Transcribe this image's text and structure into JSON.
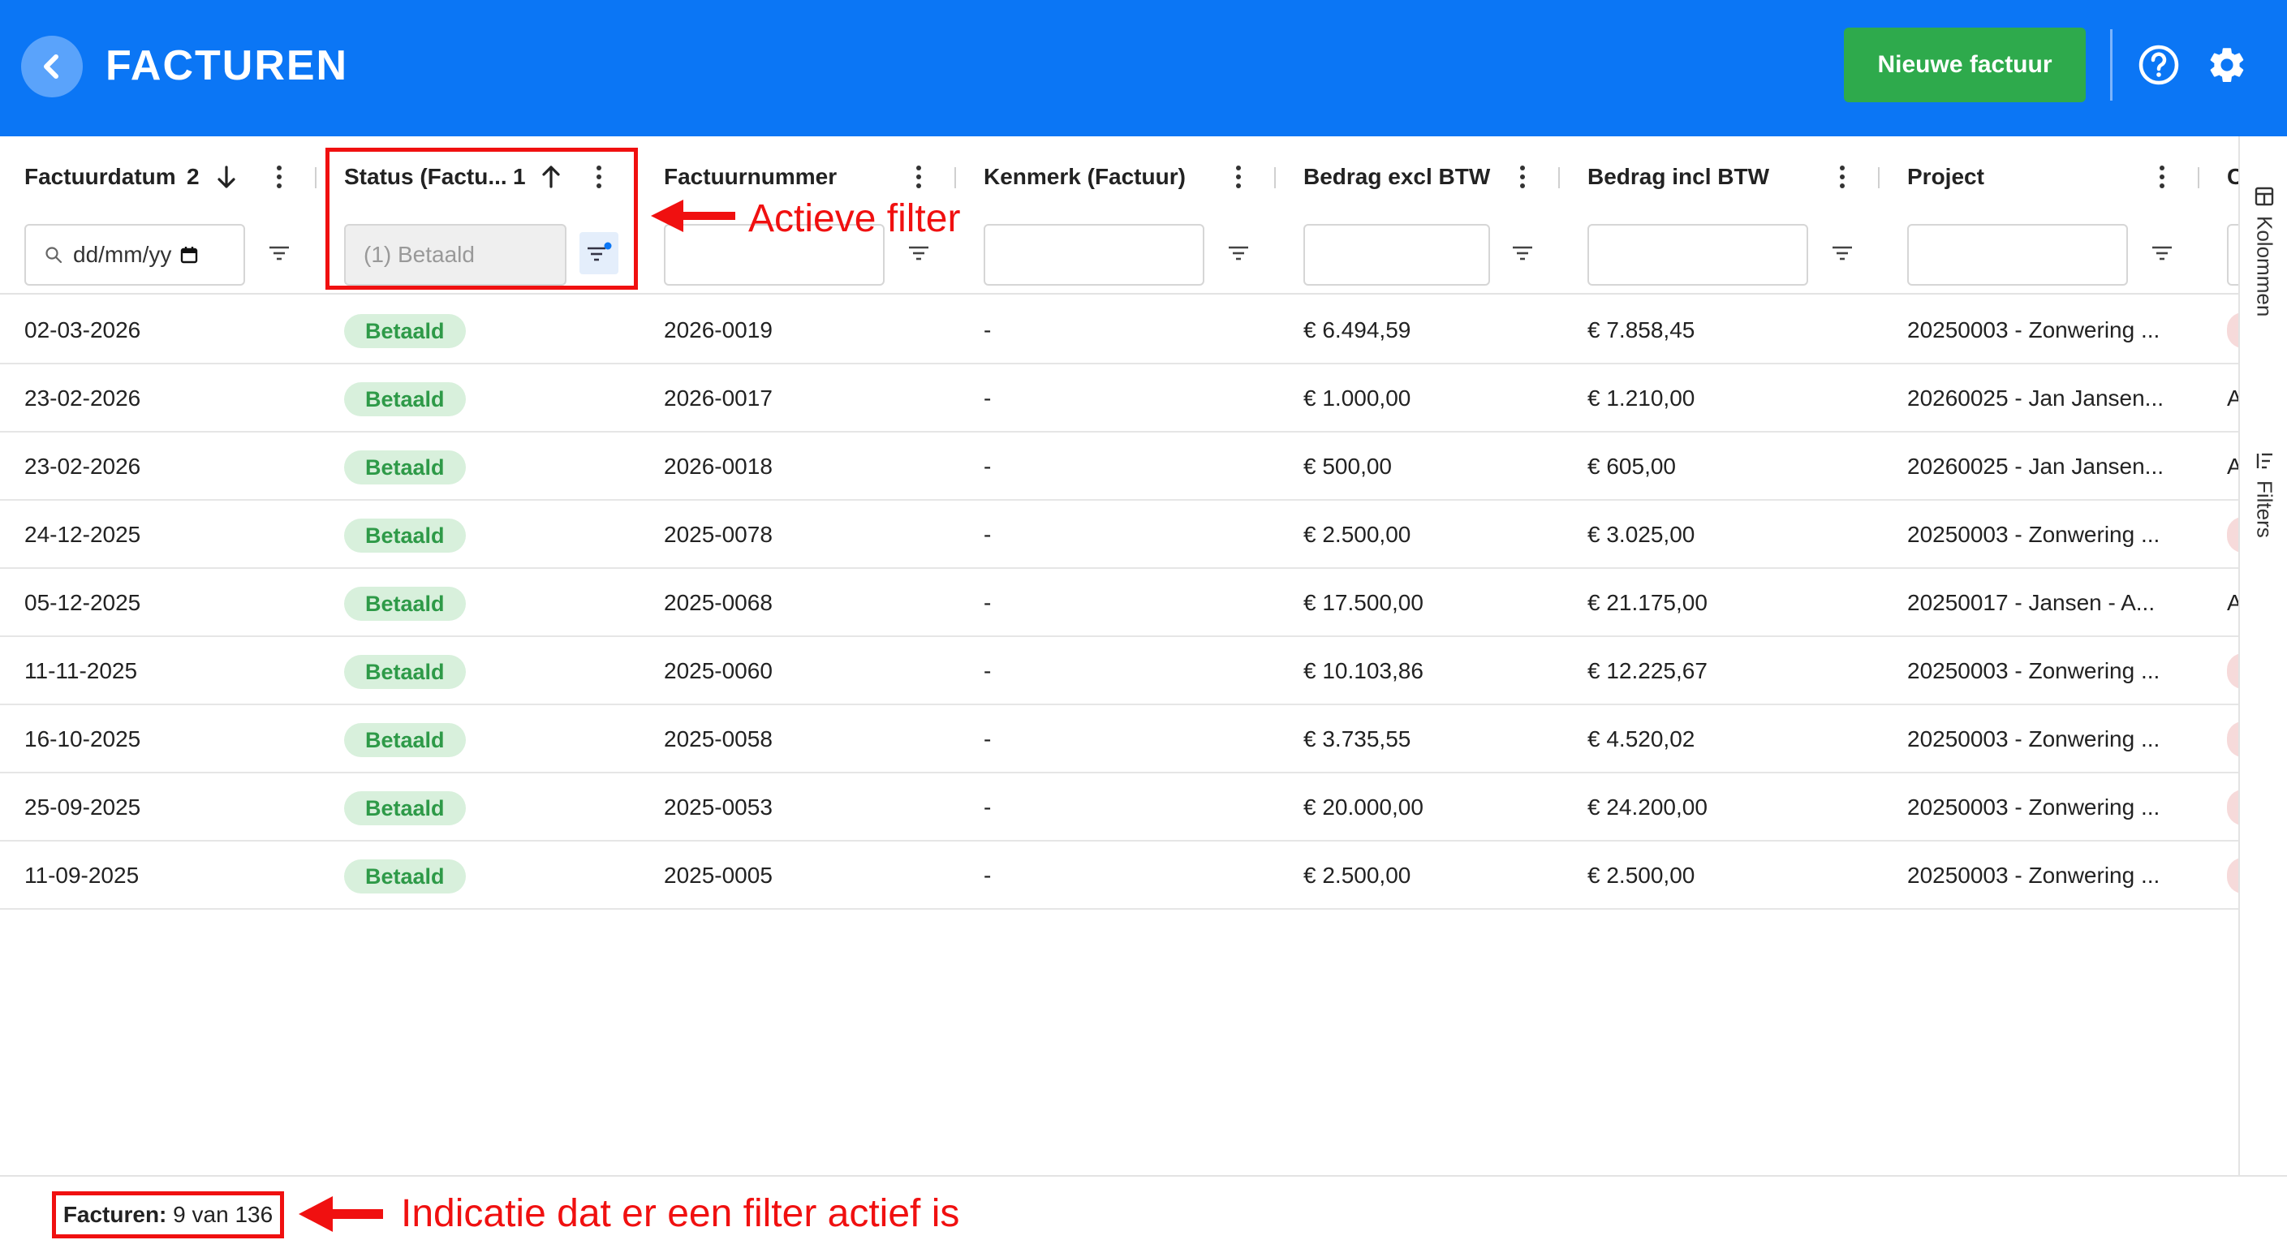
{
  "header": {
    "title": "FACTUREN",
    "new_button": "Nieuwe factuur",
    "color": "#0b76f5",
    "icons": [
      "chevron-left-icon",
      "help-circle-icon",
      "gear-icon"
    ]
  },
  "columns": [
    {
      "title": "Factuurdatum",
      "sort_index": "2",
      "sort_dir": "desc",
      "filter_placeholder": "dd/mm/yy"
    },
    {
      "title": "Status (Factu...",
      "sort_index": "1",
      "sort_dir": "asc",
      "filter_value": "(1) Betaald"
    },
    {
      "title": "Factuurnummer",
      "filter_value": ""
    },
    {
      "title": "Kenmerk (Factuur)",
      "filter_value": ""
    },
    {
      "title": "Bedrag excl BTW",
      "filter_value": ""
    },
    {
      "title": "Bedrag incl BTW",
      "filter_value": ""
    },
    {
      "title": "Project",
      "filter_value": ""
    },
    {
      "title": "C",
      "filter_value": ""
    }
  ],
  "rows": [
    {
      "date": "02-03-2026",
      "status": "Betaald",
      "number": "2026-0019",
      "reference": "-",
      "excl": "€ 6.494,59",
      "incl": "€ 7.858,45",
      "project": "20250003 - Zonwering ...",
      "peek": ""
    },
    {
      "date": "23-02-2026",
      "status": "Betaald",
      "number": "2026-0017",
      "reference": "-",
      "excl": "€ 1.000,00",
      "incl": "€ 1.210,00",
      "project": "20260025 - Jan Jansen...",
      "peek": "A"
    },
    {
      "date": "23-02-2026",
      "status": "Betaald",
      "number": "2026-0018",
      "reference": "-",
      "excl": "€ 500,00",
      "incl": "€ 605,00",
      "project": "20260025 - Jan Jansen...",
      "peek": "A"
    },
    {
      "date": "24-12-2025",
      "status": "Betaald",
      "number": "2025-0078",
      "reference": "-",
      "excl": "€ 2.500,00",
      "incl": "€ 3.025,00",
      "project": "20250003 - Zonwering ...",
      "peek": ""
    },
    {
      "date": "05-12-2025",
      "status": "Betaald",
      "number": "2025-0068",
      "reference": "-",
      "excl": "€ 17.500,00",
      "incl": "€ 21.175,00",
      "project": "20250017 - Jansen - A...",
      "peek": "A"
    },
    {
      "date": "11-11-2025",
      "status": "Betaald",
      "number": "2025-0060",
      "reference": "-",
      "excl": "€ 10.103,86",
      "incl": "€ 12.225,67",
      "project": "20250003 - Zonwering ...",
      "peek": ""
    },
    {
      "date": "16-10-2025",
      "status": "Betaald",
      "number": "2025-0058",
      "reference": "-",
      "excl": "€ 3.735,55",
      "incl": "€ 4.520,02",
      "project": "20250003 - Zonwering ...",
      "peek": ""
    },
    {
      "date": "25-09-2025",
      "status": "Betaald",
      "number": "2025-0053",
      "reference": "-",
      "excl": "€ 20.000,00",
      "incl": "€ 24.200,00",
      "project": "20250003 - Zonwering ...",
      "peek": ""
    },
    {
      "date": "11-09-2025",
      "status": "Betaald",
      "number": "2025-0005",
      "reference": "-",
      "excl": "€ 2.500,00",
      "incl": "€ 2.500,00",
      "project": "20250003 - Zonwering ...",
      "peek": ""
    }
  ],
  "side_panel": {
    "columns_label": "Kolommen",
    "filters_label": "Filters"
  },
  "footer": {
    "count_label": "Facturen:",
    "count_value": "9 van 136"
  },
  "annotations": {
    "active_filter": "Actieve filter",
    "filter_indicator": "Indicatie dat er een filter actief is",
    "color": "#f01010"
  }
}
